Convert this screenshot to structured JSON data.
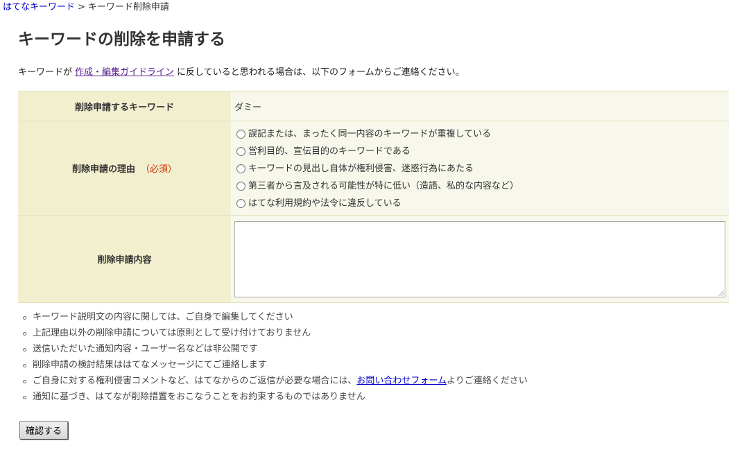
{
  "breadcrumb": {
    "home": "はてなキーワード",
    "separator": ">",
    "current": "キーワード削除申請"
  },
  "page_title": "キーワードの削除を申請する",
  "intro": {
    "before": "キーワードが",
    "link": "作成・編集ガイドライン",
    "after": "に反していると思われる場合は、以下のフォームからご連絡ください。"
  },
  "form": {
    "keyword_label": "削除申請するキーワード",
    "keyword_value": "ダミー",
    "reason_label": "削除申請の理由",
    "required_label": "（必須）",
    "reasons": [
      "誤記または、まったく同一内容のキーワードが重複している",
      "営利目的、宣伝目的のキーワードである",
      "キーワードの見出し自体が権利侵害、迷惑行為にあたる",
      "第三者から言及される可能性が特に低い（造語、私的な内容など）",
      "はてな利用規約や法令に違反している"
    ],
    "content_label": "削除申請内容",
    "content_value": ""
  },
  "notes": [
    "キーワード説明文の内容に関しては、ご自身で編集してください",
    "上記理由以外の削除申請については原則として受け付けておりません",
    "送信いただいた通知内容・ユーザー名などは非公開です",
    "削除申請の検討結果ははてなメッセージにてご連絡します",
    {
      "before": "ご自身に対する権利侵害コメントなど、はてなからのご返信が必要な場合には、",
      "link": "お問い合わせフォーム",
      "after": "よりご連絡ください"
    },
    "通知に基づき、はてなが削除措置をおこなうことをお約束するものではありません"
  ],
  "confirm_button": "確認する",
  "colors": {
    "header_cell": "#f2efcf",
    "value_cell": "#f7f7ec",
    "link": "#0000cc",
    "visited_link": "#551a8b",
    "required": "#cc3300"
  }
}
